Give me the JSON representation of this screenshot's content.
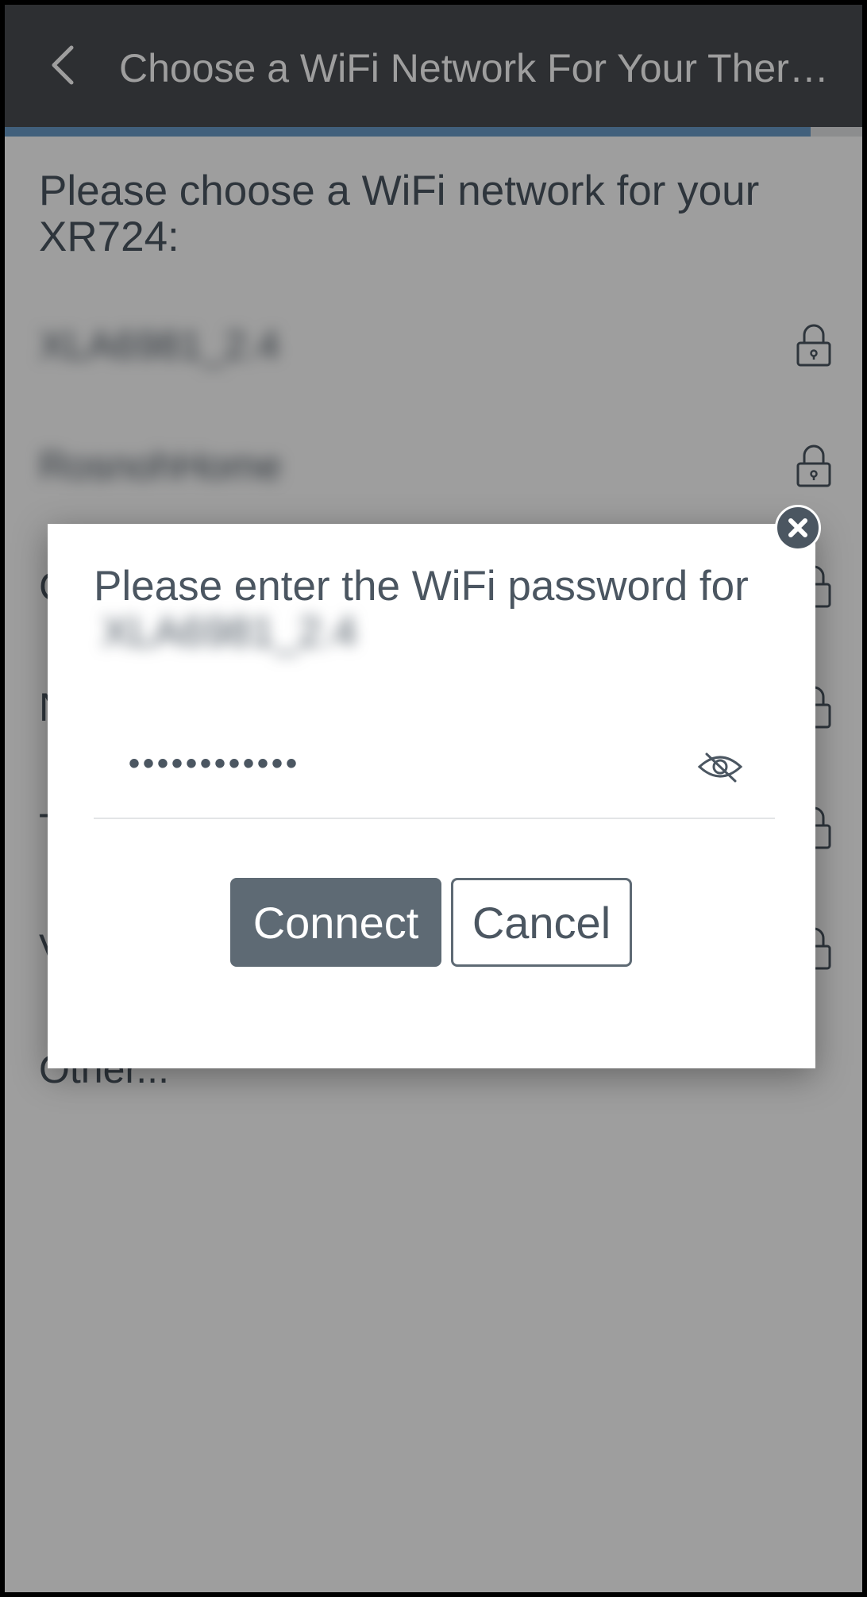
{
  "appbar": {
    "title": "Choose a WiFi Network For Your Therm..."
  },
  "progress": {
    "value_percent": 94
  },
  "content": {
    "heading": "Please choose a WiFi network for your XR724:",
    "networks": [
      {
        "name": "XLA6981_2.4",
        "locked": true
      },
      {
        "name": "RosnohHome",
        "locked": true
      },
      {
        "name": "C",
        "locked": true
      },
      {
        "name": "N",
        "locked": true
      },
      {
        "name": "T",
        "locked": true
      },
      {
        "name": "V",
        "locked": true
      }
    ],
    "other_label": "Other..."
  },
  "dialog": {
    "prompt_prefix": "Please enter the WiFi password for",
    "network_name": "XLA6981_2.4",
    "password_masked": "••••••••••••",
    "connect_label": "Connect",
    "cancel_label": "Cancel"
  },
  "icons": {
    "back": "chevron-left-icon",
    "lock": "lock-icon",
    "close": "close-icon",
    "eye": "eye-slash-icon"
  },
  "colors": {
    "appbar": "#4a4d52",
    "text": "#4b5661",
    "accent": "#6a9cc8",
    "button": "#5e6a74"
  }
}
